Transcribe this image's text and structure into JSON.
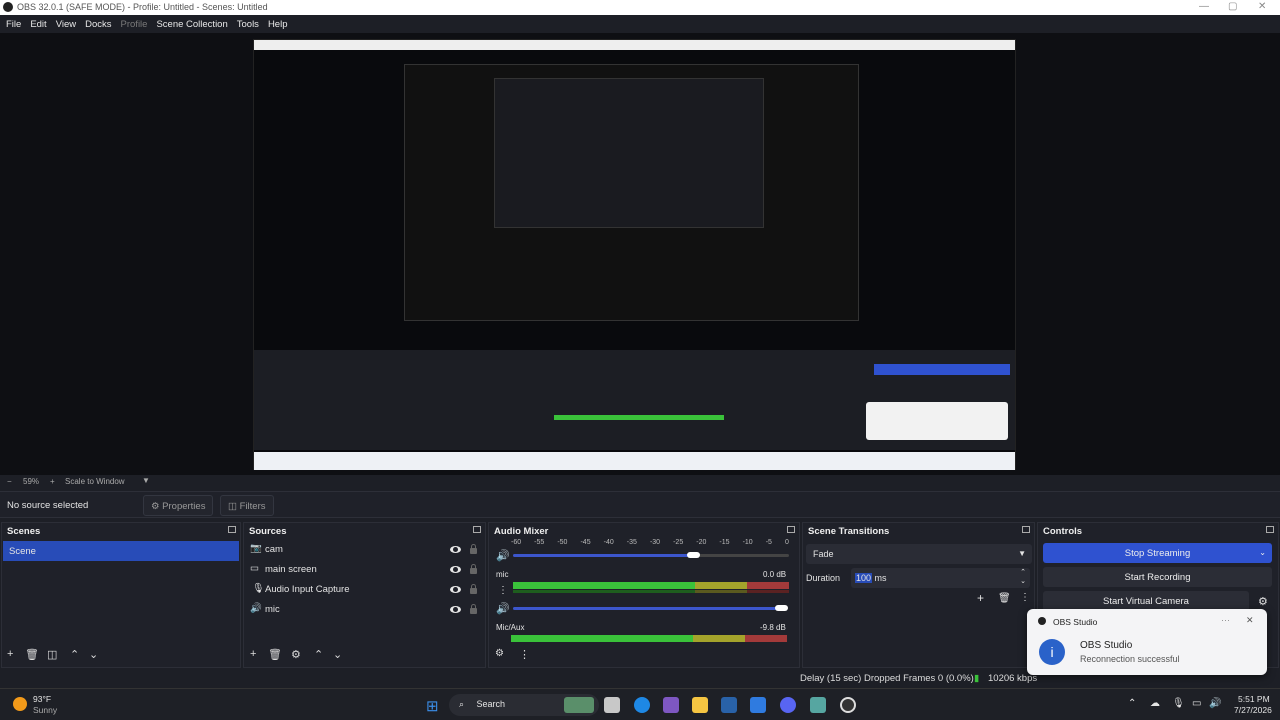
{
  "window": {
    "title": "OBS 32.0.1 (SAFE MODE) - Profile: Untitled - Scenes: Untitled"
  },
  "menu": [
    "File",
    "Edit",
    "View",
    "Docks",
    "Profile",
    "Scene Collection",
    "Tools",
    "Help"
  ],
  "zoom": {
    "level": "59%",
    "mode": "Scale to Window"
  },
  "source_bar": {
    "no_source": "No source selected",
    "properties": "Properties",
    "filters": "Filters"
  },
  "scenes": {
    "title": "Scenes",
    "items": [
      "Scene"
    ]
  },
  "sources": {
    "title": "Sources",
    "items": [
      "cam",
      "main screen",
      "Audio Input Capture",
      "mic"
    ]
  },
  "audio_mixer": {
    "title": "Audio Mixer",
    "ticks": [
      "-60",
      "-55",
      "-50",
      "-45",
      "-40",
      "-35",
      "-30",
      "-25",
      "-20",
      "-15",
      "-10",
      "-5",
      "0"
    ],
    "channels": [
      {
        "name": "mic",
        "db": "0.0 dB"
      },
      {
        "name": "Mic/Aux",
        "db": "-9.8 dB"
      }
    ]
  },
  "transitions": {
    "title": "Scene Transitions",
    "selected": "Fade",
    "duration_label": "Duration",
    "duration_value": "100",
    "duration_unit": "ms"
  },
  "controls": {
    "title": "Controls",
    "stop_streaming": "Stop Streaming",
    "start_recording": "Start Recording",
    "start_virtual_camera": "Start Virtual Camera"
  },
  "toast": {
    "app": "OBS Studio",
    "heading": "OBS Studio",
    "message": "Reconnection successful"
  },
  "status": {
    "delay": "Delay (15 sec)",
    "dropped": "Dropped Frames 0 (0.0%)",
    "bitrate": "10206 kbps"
  },
  "taskbar": {
    "weather_temp": "93°F",
    "weather_text": "Sunny",
    "search": "Search",
    "time": "5:51 PM",
    "date": "7/27/2026"
  },
  "colors": {
    "accent": "#284cb8",
    "stream_button": "#2f52d0",
    "meter_green": "#3ac23a"
  }
}
